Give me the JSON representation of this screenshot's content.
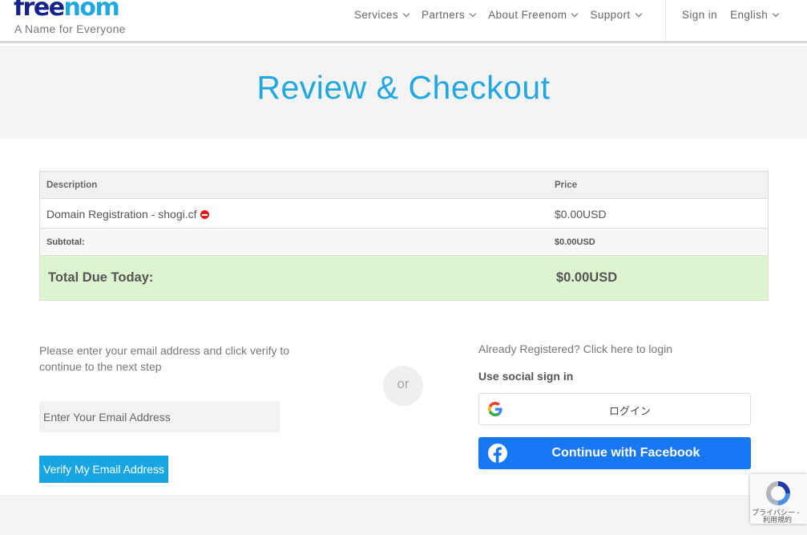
{
  "header": {
    "logo_part1": "free",
    "logo_part2": "nom",
    "tagline": "A Name for Everyone",
    "nav": [
      "Services",
      "Partners",
      "About Freenom",
      "Support"
    ],
    "sign_in": "Sign in",
    "language": "English"
  },
  "hero": {
    "title": "Review & Checkout"
  },
  "order_table": {
    "headers": {
      "description": "Description",
      "price": "Price"
    },
    "item": {
      "description": "Domain Registration - shogi.cf",
      "price": "$0.00USD"
    },
    "subtotal": {
      "label": "Subtotal:",
      "value": "$0.00USD"
    },
    "total": {
      "label": "Total Due Today:",
      "value": "$0.00USD"
    }
  },
  "email": {
    "instructions": "Please enter your email address and click verify to continue to the next step",
    "placeholder": "Enter Your Email Address",
    "verify_label": "Verify My Email Address"
  },
  "divider": {
    "or": "or"
  },
  "login": {
    "already_registered": "Already Registered? Click here to login",
    "social_title": "Use social sign in",
    "google_label": "ログイン",
    "facebook_label": "Continue with Facebook"
  },
  "recaptcha": {
    "privacy": "プライバシー -",
    "terms": "利用規約"
  },
  "colors": {
    "accent": "#22a7e0",
    "facebook": "#1877f2",
    "total_bg": "#def3cf",
    "remove": "#e01b1b"
  }
}
